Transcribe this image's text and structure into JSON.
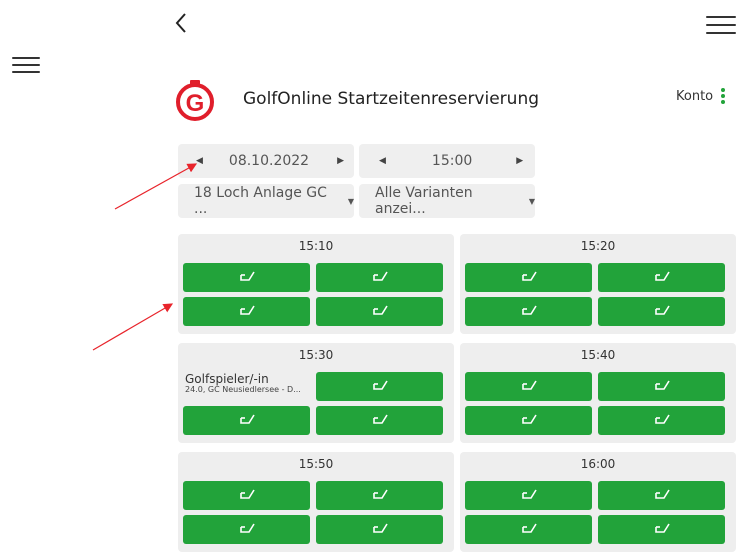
{
  "header": {
    "back_icon": "chevron-left-icon",
    "menu_icon": "hamburger-icon",
    "title": "GolfOnline Startzeitenreservierung",
    "account_label": "Konto",
    "account_icon": "vertical-dots-icon",
    "accent_color": "#22a33a",
    "logo_color": "#e01e2b"
  },
  "filters": {
    "date": "08.10.2022",
    "time": "15:00",
    "course": "18 Loch Anlage GC ...",
    "variant": "Alle Varianten anzei..."
  },
  "slots": [
    {
      "time": "15:10"
    },
    {
      "time": "15:20"
    },
    {
      "time": "15:30",
      "booked_name": "Golfspieler/-in",
      "booked_club": "24.0, GC Neusiedlersee - D..."
    },
    {
      "time": "15:40"
    },
    {
      "time": "15:50"
    },
    {
      "time": "16:00"
    }
  ]
}
